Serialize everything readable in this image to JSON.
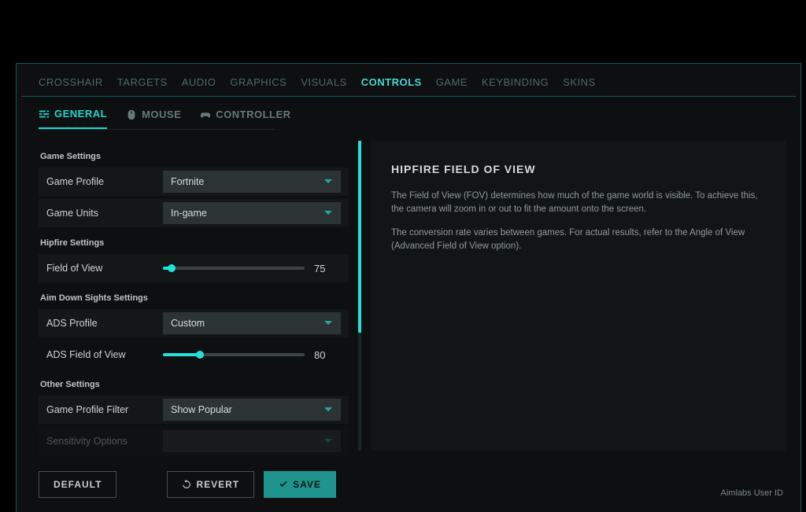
{
  "tabs": {
    "items": [
      "CROSSHAIR",
      "TARGETS",
      "AUDIO",
      "GRAPHICS",
      "VISUALS",
      "CONTROLS",
      "GAME",
      "KEYBINDING",
      "SKINS"
    ],
    "active": "CONTROLS"
  },
  "subTabs": {
    "items": [
      "GENERAL",
      "MOUSE",
      "CONTROLLER"
    ],
    "active": "GENERAL"
  },
  "sections": {
    "gameSettings": {
      "title": "Game Settings",
      "gameProfile": {
        "label": "Game Profile",
        "value": "Fortnite"
      },
      "gameUnits": {
        "label": "Game Units",
        "value": "In-game"
      }
    },
    "hipfire": {
      "title": "Hipfire Settings",
      "fov": {
        "label": "Field of View",
        "value": 75,
        "min": 60,
        "max": 180
      }
    },
    "ads": {
      "title": "Aim Down Sights Settings",
      "profile": {
        "label": "ADS Profile",
        "value": "Custom"
      },
      "fov": {
        "label": "ADS Field of View",
        "value": 80,
        "min": 60,
        "max": 180
      }
    },
    "other": {
      "title": "Other Settings",
      "filter": {
        "label": "Game Profile Filter",
        "value": "Show Popular"
      },
      "truncated": {
        "label": "Sensitivity Options",
        "value": ""
      }
    }
  },
  "detail": {
    "title": "HIPFIRE FIELD OF VIEW",
    "p1": "The Field of View (FOV) determines how much of the game world is visible. To achieve this, the camera will zoom in or out to fit the amount onto the screen.",
    "p2": "The conversion rate varies between games. For actual results, refer to the Angle of View (Advanced Field of View option)."
  },
  "buttons": {
    "default": "DEFAULT",
    "revert": "REVERT",
    "save": "SAVE"
  },
  "footer": {
    "userId": "Aimlabs User ID"
  }
}
